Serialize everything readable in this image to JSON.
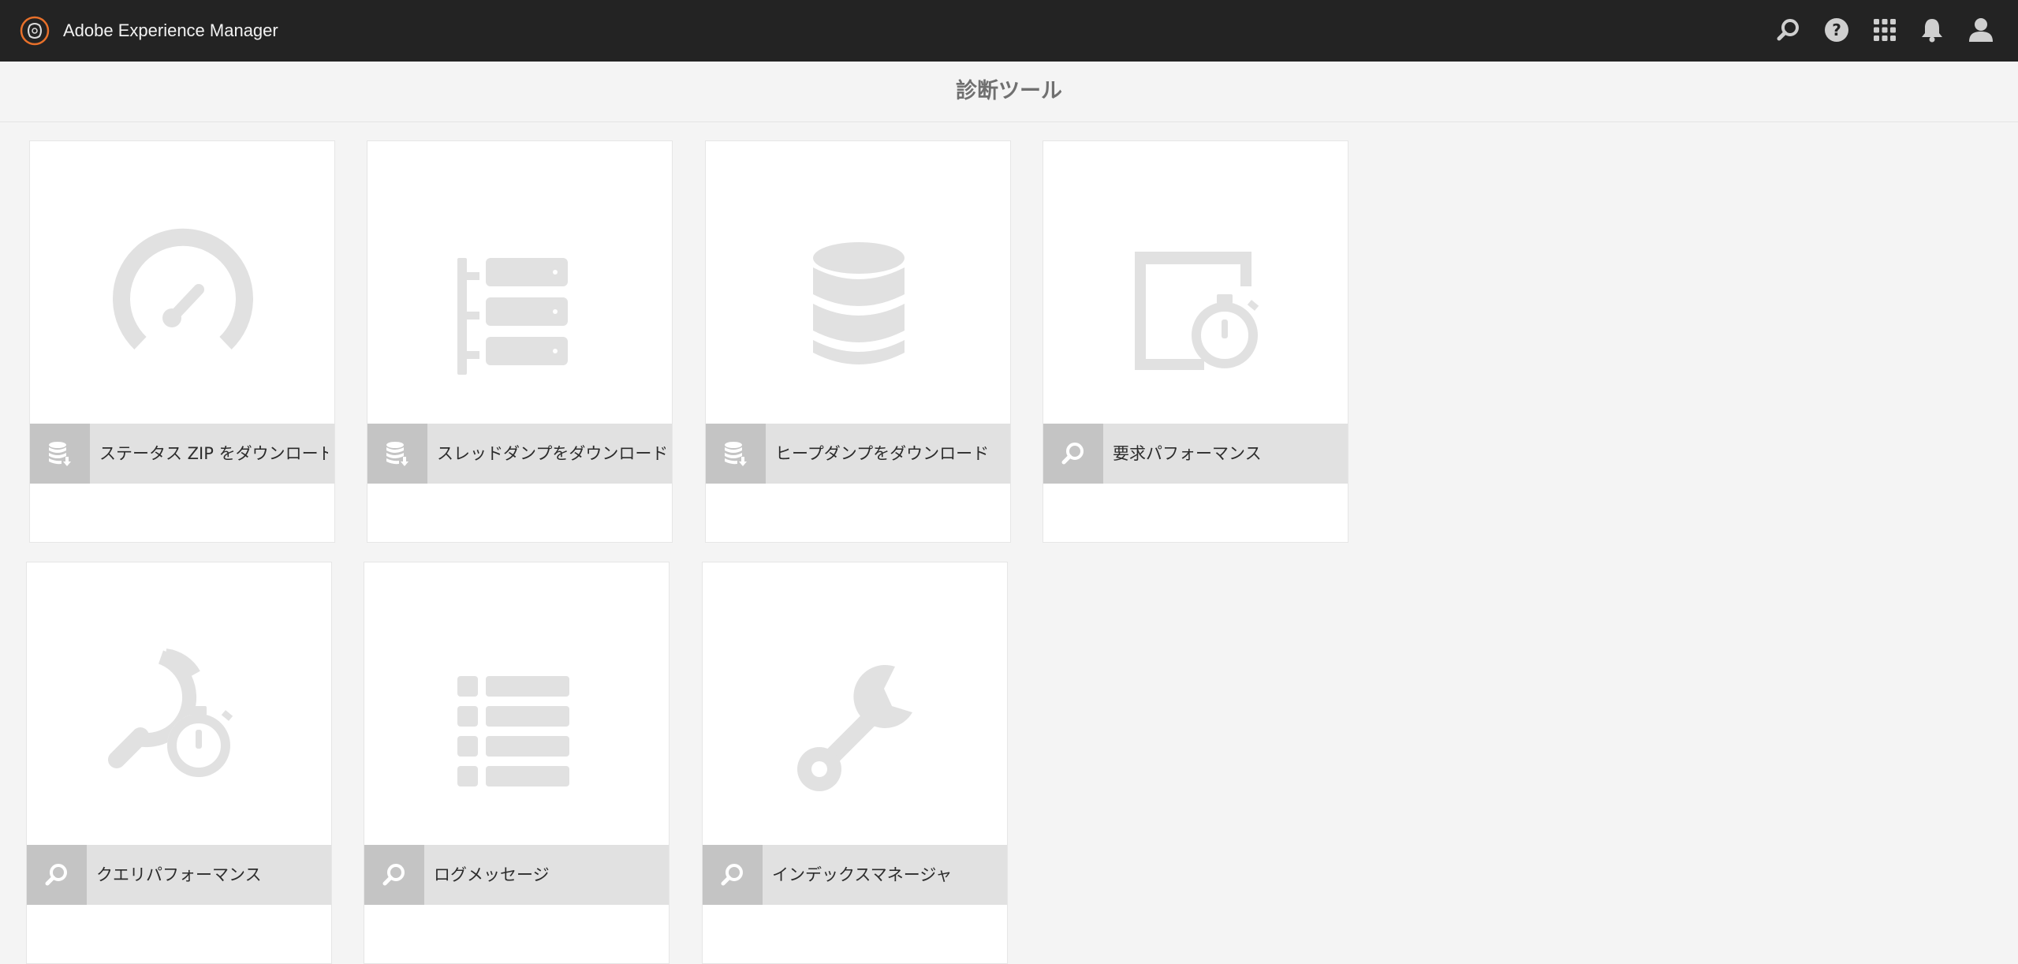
{
  "app": {
    "title": "Adobe Experience Manager"
  },
  "header_icons": [
    "search-icon",
    "help-icon",
    "apps-grid-icon",
    "notification-bell-icon",
    "user-icon"
  ],
  "page": {
    "title": "診断ツール"
  },
  "cards": [
    {
      "label": "ステータス ZIP をダウンロード",
      "thumb_icon": "speedometer-icon",
      "badge_icon": "database-download-icon"
    },
    {
      "label": "スレッドダンプをダウンロード",
      "thumb_icon": "server-tree-icon",
      "badge_icon": "database-download-icon"
    },
    {
      "label": "ヒープダンプをダウンロード",
      "thumb_icon": "database-icon",
      "badge_icon": "database-download-icon"
    },
    {
      "label": "要求パフォーマンス",
      "thumb_icon": "window-stopwatch-icon",
      "badge_icon": "search-icon"
    },
    {
      "label": "クエリパフォーマンス",
      "thumb_icon": "search-stopwatch-icon",
      "badge_icon": "search-icon"
    },
    {
      "label": "ログメッセージ",
      "thumb_icon": "list-icon",
      "badge_icon": "search-icon"
    },
    {
      "label": "インデックスマネージャ",
      "thumb_icon": "wrench-icon",
      "badge_icon": "search-icon"
    }
  ],
  "colors": {
    "topbar": "#232323",
    "background": "#f4f4f4",
    "icon_gray": "#e1e1e1",
    "badge": "#c4c4c4",
    "logo_ring": "#e8702a"
  }
}
